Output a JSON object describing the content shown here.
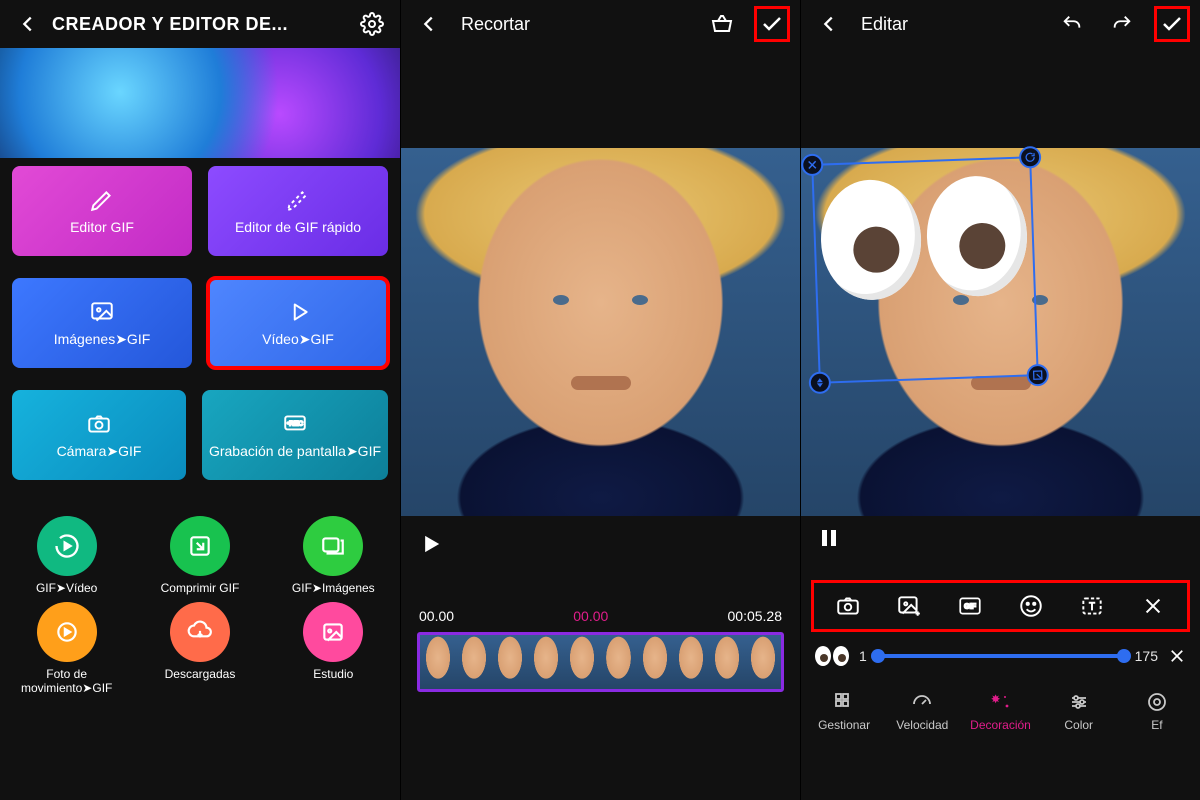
{
  "panel1": {
    "title": "CREADOR Y EDITOR DE...",
    "tiles": {
      "editor_gif": "Editor GIF",
      "editor_gif_rapido": "Editor de GIF rápido",
      "imagenes_gif": "Imágenes➤GIF",
      "video_gif": "Vídeo➤GIF",
      "camara_gif": "Cámara➤GIF",
      "grabacion_gif": "Grabación de pantalla➤GIF"
    },
    "circles": {
      "gif_video": "GIF➤Vídeo",
      "comprimir": "Comprimir GIF",
      "gif_imagenes": "GIF➤Imágenes",
      "foto_mov": "Foto de movimiento➤GIF",
      "descargadas": "Descargadas",
      "estudio": "Estudio"
    }
  },
  "panel2": {
    "title": "Recortar",
    "time_start": "00.00",
    "time_current": "00.00",
    "time_end": "00:05.28"
  },
  "panel3": {
    "title": "Editar",
    "slider_min": "1",
    "slider_max": "175",
    "bottom": {
      "gestionar": "Gestionar",
      "velocidad": "Velocidad",
      "decoracion": "Decoración",
      "color": "Color",
      "efecto": "Ef"
    }
  }
}
